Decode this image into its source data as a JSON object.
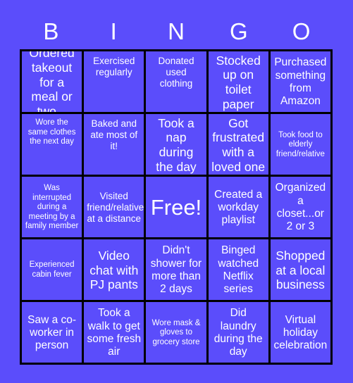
{
  "card": {
    "background_color": "#5b4dfb",
    "grid_line_color": "#000000",
    "text_color": "#ffffff",
    "title_letters": [
      "B",
      "I",
      "N",
      "G",
      "O"
    ],
    "columns": 5,
    "rows": 5,
    "free_space": {
      "label": "Free!",
      "row": 3,
      "column": 3
    },
    "squares": [
      [
        {
          "text": "Ordered takeout for a meal or two...",
          "size": "lg",
          "align": "center"
        },
        {
          "text": "Exercised regularly",
          "size": "sm",
          "align": "top"
        },
        {
          "text": "Donated used clothing",
          "size": "sm",
          "align": "top"
        },
        {
          "text": "Stocked up on toilet paper",
          "size": "lg",
          "align": "center"
        },
        {
          "text": "Purchased something from Amazon",
          "size": "md",
          "align": "center"
        }
      ],
      [
        {
          "text": "Wore the same clothes the next day",
          "size": "xs",
          "align": "top"
        },
        {
          "text": "Baked and ate most of it!",
          "size": "sm",
          "align": "top"
        },
        {
          "text": "Took a nap during the day",
          "size": "lg",
          "align": "center"
        },
        {
          "text": "Got frustrated with a loved one",
          "size": "lg",
          "align": "center"
        },
        {
          "text": "Took food to elderly friend/relative",
          "size": "xs",
          "align": "center"
        }
      ],
      [
        {
          "text": "Was interrupted during a meeting by a family member",
          "size": "xs",
          "align": "center"
        },
        {
          "text": "Visited friend/relative at a distance",
          "size": "sm",
          "align": "center"
        },
        {
          "text": "Free!",
          "size": "free",
          "align": "center"
        },
        {
          "text": "Created a workday playlist",
          "size": "md",
          "align": "center"
        },
        {
          "text": "Organized a closet...or 2 or 3",
          "size": "md",
          "align": "center"
        }
      ],
      [
        {
          "text": "Experienced cabin fever",
          "size": "xs",
          "align": "center"
        },
        {
          "text": "Video chat with PJ pants",
          "size": "lg",
          "align": "center"
        },
        {
          "text": "Didn't shower for more than 2 days",
          "size": "md",
          "align": "center"
        },
        {
          "text": "Binged watched Netflix series",
          "size": "md",
          "align": "center"
        },
        {
          "text": "Shopped at a local business",
          "size": "lg",
          "align": "center"
        }
      ],
      [
        {
          "text": "Saw a co-worker in person",
          "size": "md",
          "align": "center"
        },
        {
          "text": "Took a walk to get some fresh air",
          "size": "md",
          "align": "center"
        },
        {
          "text": "Wore mask & gloves to grocery store",
          "size": "xs",
          "align": "center"
        },
        {
          "text": "Did laundry during the day",
          "size": "md",
          "align": "center"
        },
        {
          "text": "Virtual holiday celebration",
          "size": "md",
          "align": "center"
        }
      ]
    ]
  }
}
